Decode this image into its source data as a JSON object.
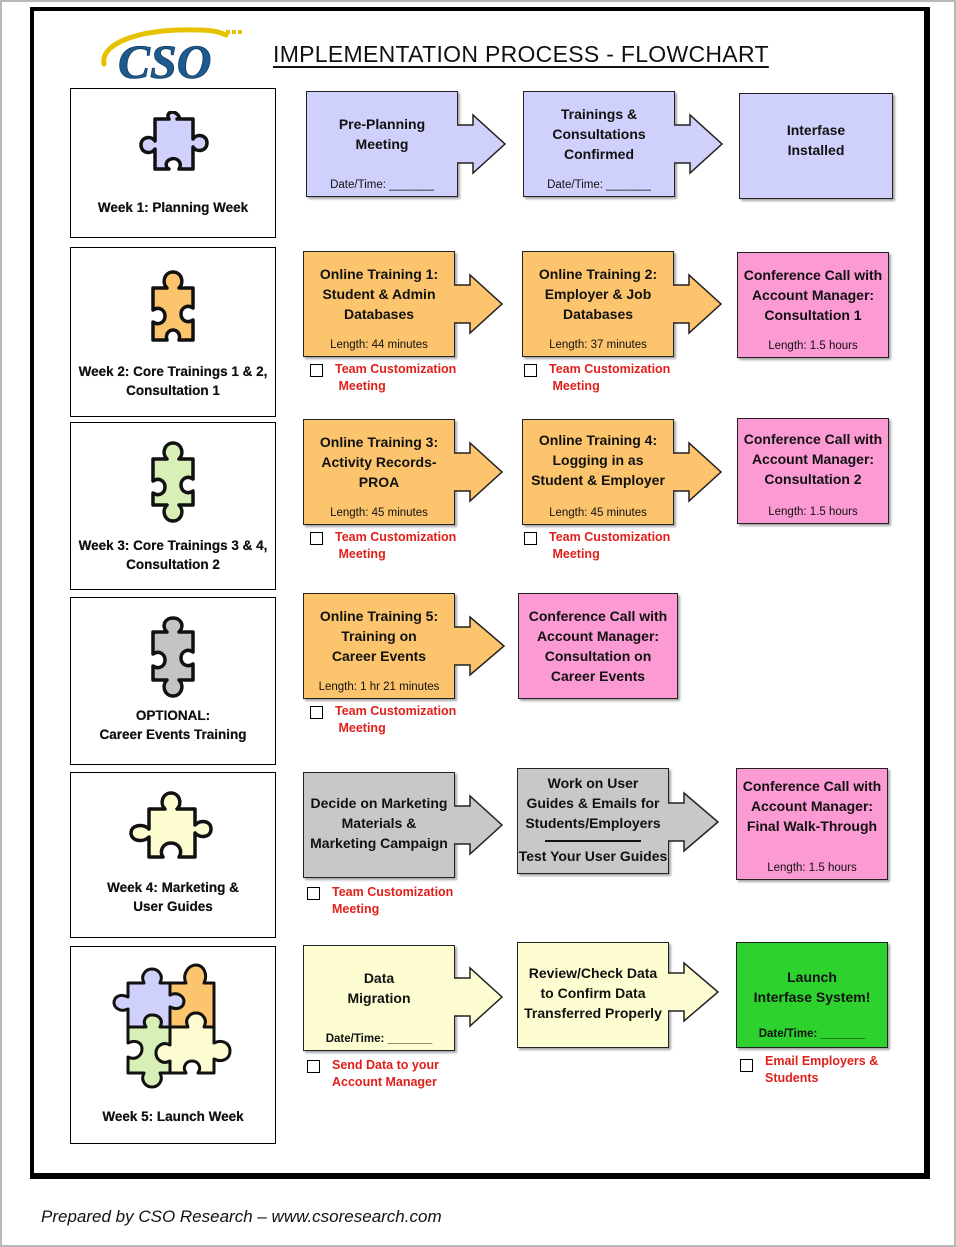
{
  "header": {
    "logo_text": "CSO",
    "title": "IMPLEMENTATION PROCESS - FLOWCHART"
  },
  "colors": {
    "lavender": "#d0d0fc",
    "orange": "#fcc46c",
    "pink": "#fc9ad4",
    "gray": "#c8c8c8",
    "yellow": "#fdfdd1",
    "green": "#2ed22e",
    "checklist_red": "#e0201b",
    "logo_blue": "#1f5a8c",
    "logo_gold": "#e6c200"
  },
  "rows": [
    {
      "week_label": [
        "Week 1: Planning Week"
      ],
      "puzzle_icon": "puzzle-piece-lavender",
      "steps": [
        {
          "lines": [
            "Pre-Planning",
            "Meeting"
          ],
          "sub": "Date/Time: _______",
          "color": "lavender"
        },
        {
          "lines": [
            "Trainings &",
            "Consultations",
            "Confirmed"
          ],
          "sub": "Date/Time: _______",
          "color": "lavender"
        },
        {
          "lines": [
            "Interfase",
            "Installed"
          ],
          "sub": "",
          "color": "lavender"
        }
      ],
      "checklist": []
    },
    {
      "week_label": [
        "Week 2: Core Trainings 1 & 2,",
        "Consultation 1"
      ],
      "puzzle_icon": "puzzle-piece-orange",
      "steps": [
        {
          "lines": [
            "Online Training 1:",
            "Student & Admin",
            "Databases"
          ],
          "sub": "Length: 44 minutes",
          "color": "orange"
        },
        {
          "lines": [
            "Online Training 2:",
            "Employer & Job",
            "Databases"
          ],
          "sub": "Length: 37 minutes",
          "color": "orange"
        },
        {
          "lines": [
            "Conference Call with",
            "Account Manager:",
            "Consultation 1"
          ],
          "sub": "Length: 1.5 hours",
          "color": "pink"
        }
      ],
      "checklist": [
        {
          "lines": [
            "Team Customization",
            "Meeting"
          ],
          "checked": false
        },
        {
          "lines": [
            "Team Customization",
            "Meeting"
          ],
          "checked": false
        }
      ]
    },
    {
      "week_label": [
        "Week 3: Core Trainings 3 & 4,",
        "Consultation 2"
      ],
      "puzzle_icon": "puzzle-piece-green",
      "steps": [
        {
          "lines": [
            "Online Training 3:",
            "Activity Records-",
            "PROA"
          ],
          "sub": "Length: 45 minutes",
          "color": "orange"
        },
        {
          "lines": [
            "Online Training 4:",
            "Logging in as",
            "Student & Employer"
          ],
          "sub": "Length:  45 minutes",
          "color": "orange"
        },
        {
          "lines": [
            "Conference Call with",
            "Account Manager:",
            "Consultation 2"
          ],
          "sub": "Length: 1.5 hours",
          "color": "pink"
        }
      ],
      "checklist": [
        {
          "lines": [
            "Team Customization",
            "Meeting"
          ],
          "checked": false
        },
        {
          "lines": [
            "Team Customization",
            "Meeting"
          ],
          "checked": false
        }
      ]
    },
    {
      "week_label": [
        "OPTIONAL:",
        "Career Events Training"
      ],
      "puzzle_icon": "puzzle-piece-gray",
      "steps": [
        {
          "lines": [
            "Online Training 5:",
            "Training on",
            "Career Events"
          ],
          "sub": "Length:  1 hr 21 minutes",
          "color": "orange"
        },
        {
          "lines": [
            "Conference Call with",
            "Account Manager:",
            "Consultation on",
            "Career Events"
          ],
          "sub": "",
          "color": "pink"
        }
      ],
      "checklist": [
        {
          "lines": [
            "Team Customization",
            "Meeting"
          ],
          "checked": false
        }
      ]
    },
    {
      "week_label": [
        "Week 4: Marketing &",
        "User Guides"
      ],
      "puzzle_icon": "puzzle-piece-yellow",
      "steps": [
        {
          "lines": [
            "Decide on Marketing",
            "Materials &",
            "Marketing Campaign"
          ],
          "sub": "",
          "color": "gray"
        },
        {
          "lines": [
            "Work on User",
            "Guides & Emails for",
            "Students/Employers"
          ],
          "lines2": [
            "Test Your User Guides"
          ],
          "sub": "",
          "color": "gray"
        },
        {
          "lines": [
            "Conference Call with",
            "Account Manager:",
            "Final Walk-Through"
          ],
          "sub": "Length: 1.5 hours",
          "color": "pink"
        }
      ],
      "checklist": [
        {
          "lines": [
            "Team Customization",
            "Meeting"
          ],
          "checked": false
        }
      ]
    },
    {
      "week_label": [
        "Week 5: Launch Week"
      ],
      "puzzle_icon": "puzzle-four-pieces",
      "steps": [
        {
          "lines": [
            "Data",
            "Migration"
          ],
          "sub": "Date/Time: _______",
          "color": "yellow"
        },
        {
          "lines": [
            "Review/Check Data",
            "to Confirm Data",
            "Transferred Properly"
          ],
          "sub": "",
          "color": "yellow"
        },
        {
          "lines": [
            "Launch",
            "Interfase System!"
          ],
          "sub": "Date/Time: _______",
          "color": "green"
        }
      ],
      "checklist": [
        {
          "lines": [
            "Send Data to your",
            "Account Manager"
          ],
          "checked": false
        },
        {
          "lines": [
            "Email Employers &",
            "Students"
          ],
          "checked": false
        }
      ]
    }
  ],
  "footer": {
    "text": "Prepared by CSO Research – www.csoresearch.com"
  }
}
